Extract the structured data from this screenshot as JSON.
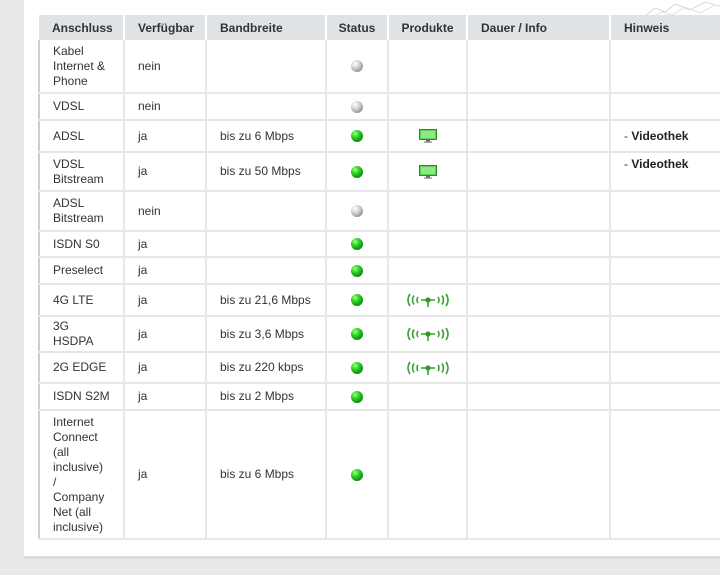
{
  "headers": {
    "anschluss": "Anschluss",
    "verfuegbar": "Verfügbar",
    "bandbreite": "Bandbreite",
    "status": "Status",
    "produkte": "Produkte",
    "dauer": "Dauer / Info",
    "hinweis": "Hinweis"
  },
  "rows": [
    {
      "anschluss": [
        "Kabel",
        "Internet &",
        "Phone"
      ],
      "verfuegbar": "nein",
      "bandbreite": "",
      "status": "grey",
      "produkt": "",
      "hinweis_prefix": "",
      "hinweis": ""
    },
    {
      "anschluss": [
        "VDSL"
      ],
      "verfuegbar": "nein",
      "bandbreite": "",
      "status": "grey",
      "produkt": "",
      "hinweis_prefix": "",
      "hinweis": ""
    },
    {
      "anschluss": [
        "ADSL"
      ],
      "verfuegbar": "ja",
      "bandbreite": "bis zu 6 Mbps",
      "status": "green",
      "produkt": "monitor-icon",
      "hinweis_prefix": "- ",
      "hinweis": "Videothek"
    },
    {
      "anschluss": [
        "VDSL",
        "Bitstream"
      ],
      "verfuegbar": "ja",
      "bandbreite": "bis zu 50 Mbps",
      "status": "green",
      "produkt": "monitor-icon",
      "hinweis_prefix": "- ",
      "hinweis": "Videothek"
    },
    {
      "anschluss": [
        "ADSL",
        "Bitstream"
      ],
      "verfuegbar": "nein",
      "bandbreite": "",
      "status": "grey",
      "produkt": "",
      "hinweis_prefix": "",
      "hinweis": ""
    },
    {
      "anschluss": [
        "ISDN S0"
      ],
      "verfuegbar": "ja",
      "bandbreite": "",
      "status": "green",
      "produkt": "",
      "hinweis_prefix": "",
      "hinweis": ""
    },
    {
      "anschluss": [
        "Preselect"
      ],
      "verfuegbar": "ja",
      "bandbreite": "",
      "status": "green",
      "produkt": "",
      "hinweis_prefix": "",
      "hinweis": ""
    },
    {
      "anschluss": [
        "4G LTE"
      ],
      "verfuegbar": "ja",
      "bandbreite": "bis zu 21,6 Mbps",
      "status": "green",
      "produkt": "antenna-icon",
      "hinweis_prefix": "",
      "hinweis": ""
    },
    {
      "anschluss": [
        "3G",
        "HSDPA"
      ],
      "verfuegbar": "ja",
      "bandbreite": "bis zu 3,6 Mbps",
      "status": "green",
      "produkt": "antenna-icon",
      "hinweis_prefix": "",
      "hinweis": ""
    },
    {
      "anschluss": [
        "2G EDGE"
      ],
      "verfuegbar": "ja",
      "bandbreite": "bis zu 220 kbps",
      "status": "green",
      "produkt": "antenna-icon",
      "hinweis_prefix": "",
      "hinweis": ""
    },
    {
      "anschluss": [
        "ISDN S2M"
      ],
      "verfuegbar": "ja",
      "bandbreite": "bis zu 2 Mbps",
      "status": "green",
      "produkt": "",
      "hinweis_prefix": "",
      "hinweis": ""
    },
    {
      "anschluss": [
        "Internet",
        "Connect",
        "(all",
        "inclusive)",
        "/",
        "Company",
        "Net (all",
        "inclusive)"
      ],
      "verfuegbar": "ja",
      "bandbreite": "bis zu 6 Mbps",
      "status": "green",
      "produkt": "",
      "hinweis_prefix": "",
      "hinweis": ""
    }
  ],
  "colors": {
    "status_green": "#1fb81e",
    "status_grey": "#9a9a9a",
    "header_bg": "#dfe3e6",
    "product_green": "#39b54a"
  }
}
